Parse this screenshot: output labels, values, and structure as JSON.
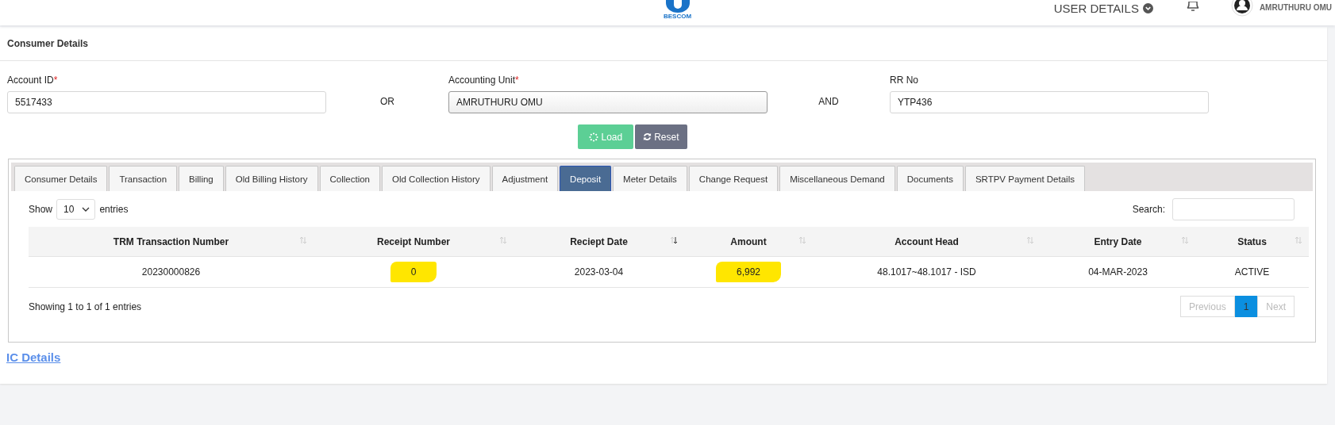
{
  "header": {
    "logo_caption": "BESCOM",
    "user_menu": "USER DETAILS",
    "user_name": "AMRUTHURU OMU"
  },
  "card_title": "Consumer Details",
  "fields": [
    {
      "kind": "text",
      "label": "Account ID",
      "required_mark": "*",
      "value": "5517433"
    },
    {
      "kind": "connector",
      "label": "OR"
    },
    {
      "kind": "select",
      "label": "Accounting Unit",
      "required_mark": "*",
      "value": "AMRUTHURU OMU"
    },
    {
      "kind": "connector",
      "label": "AND"
    },
    {
      "kind": "text",
      "label": "RR No",
      "value": "YTP436"
    }
  ],
  "buttons": [
    {
      "kind": "load",
      "label": "Load"
    },
    {
      "kind": "reset",
      "label": "Reset"
    }
  ],
  "tabs": [
    {
      "label": "Consumer Details",
      "selected": false
    },
    {
      "label": "Transaction",
      "selected": false
    },
    {
      "label": "Billing",
      "selected": false
    },
    {
      "label": "Old Billing History",
      "selected": false
    },
    {
      "label": "Collection",
      "selected": false
    },
    {
      "label": "Old Collection History",
      "selected": false
    },
    {
      "label": "Adjustment",
      "selected": false
    },
    {
      "label": "Deposit",
      "selected": true
    },
    {
      "label": "Meter Details",
      "selected": false
    },
    {
      "label": "Change Request",
      "selected": false
    },
    {
      "label": "Miscellaneous Demand",
      "selected": false
    },
    {
      "label": "Documents",
      "selected": false
    },
    {
      "label": "SRTPV Payment Details",
      "selected": false
    }
  ],
  "table": {
    "show_label": "Show",
    "page_size": "10",
    "entries_label": "entries",
    "search_label": "Search:",
    "columns": [
      {
        "label": "TRM Transaction Number",
        "sorted": false
      },
      {
        "label": "Receipt Number",
        "sorted": false
      },
      {
        "label": "Reciept Date",
        "sorted": true
      },
      {
        "label": "Amount",
        "sorted": false
      },
      {
        "label": "Account Head",
        "sorted": false
      },
      {
        "label": "Entry Date",
        "sorted": false
      },
      {
        "label": "Status",
        "sorted": false
      }
    ],
    "rows": [
      {
        "cells": [
          {
            "text": "20230000826",
            "highlighted": false
          },
          {
            "text": "0",
            "highlighted": true
          },
          {
            "text": "2023-03-04",
            "highlighted": false
          },
          {
            "text": "6,992",
            "highlighted": true
          },
          {
            "text": "48.1017~48.1017 - ISD",
            "highlighted": false
          },
          {
            "text": "04-MAR-2023",
            "highlighted": false
          },
          {
            "text": "ACTIVE",
            "highlighted": false
          }
        ]
      }
    ],
    "info": "Showing 1 to 1 of 1 entries",
    "pagination": [
      {
        "label": "Previous",
        "selected": false,
        "disabled": true
      },
      {
        "label": "1",
        "selected": true,
        "disabled": false
      },
      {
        "label": "Next",
        "selected": false,
        "disabled": true
      }
    ]
  },
  "link": "IC Details"
}
